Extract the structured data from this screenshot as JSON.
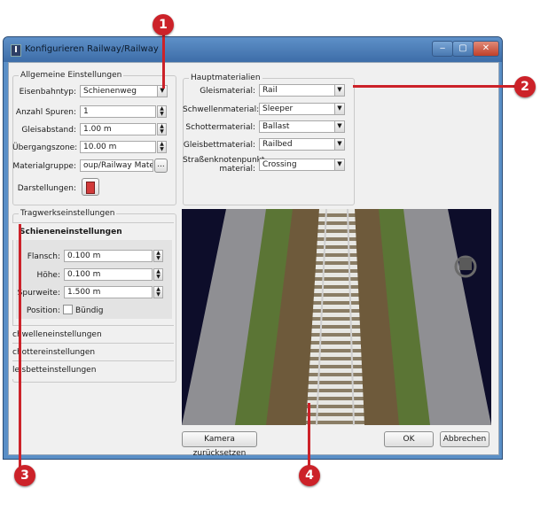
{
  "window": {
    "title": "Konfigurieren Railway/Railway",
    "min": "‒",
    "max": "▢",
    "close": "✕"
  },
  "general": {
    "legend": "Allgemeine Einstellungen",
    "bahntyp_label": "Eisenbahntyp:",
    "bahntyp_value": "Schienenweg",
    "spuren_label": "Anzahl Spuren:",
    "spuren_value": "1",
    "gleisabstand_label": "Gleisabstand:",
    "gleisabstand_value": "1.00 m",
    "uebergang_label": "Übergangszone:",
    "uebergang_value": "10.00 m",
    "materialgruppe_label": "Materialgruppe:",
    "materialgruppe_value": "oup/Railway Materials",
    "materialgruppe_btn": "...",
    "darstellungen_label": "Darstellungen:"
  },
  "materials": {
    "legend": "Hauptmaterialien",
    "rows": [
      {
        "label": "Gleismaterial:",
        "value": "Rail"
      },
      {
        "label": "Schwellenmaterial:",
        "value": "Sleeper"
      },
      {
        "label": "Schottermaterial:",
        "value": "Ballast"
      },
      {
        "label": "Gleisbettmaterial:",
        "value": "Railbed"
      }
    ],
    "crossing_label_1": "Straßenknotenpunkt-",
    "crossing_label_2": "material:",
    "crossing_value": "Crossing"
  },
  "structure": {
    "legend": "Tragwerkseinstellungen",
    "active_tab": "Schieneneinstellungen",
    "flansch_label": "Flansch:",
    "flansch_value": "0.100 m",
    "hoehe_label": "Höhe:",
    "hoehe_value": "0.100 m",
    "spurweite_label": "Spurweite:",
    "spurweite_value": "1.500 m",
    "position_label": "Position:",
    "position_check_label": "Bündig",
    "tabs": [
      "chwelleneinstellungen",
      "chottereinstellungen",
      "leisbetteinstellungen"
    ]
  },
  "buttons": {
    "camera": "Kamera zurücksetzen",
    "ok": "OK",
    "cancel": "Abbrechen"
  },
  "callouts": [
    "1",
    "2",
    "3",
    "4"
  ]
}
